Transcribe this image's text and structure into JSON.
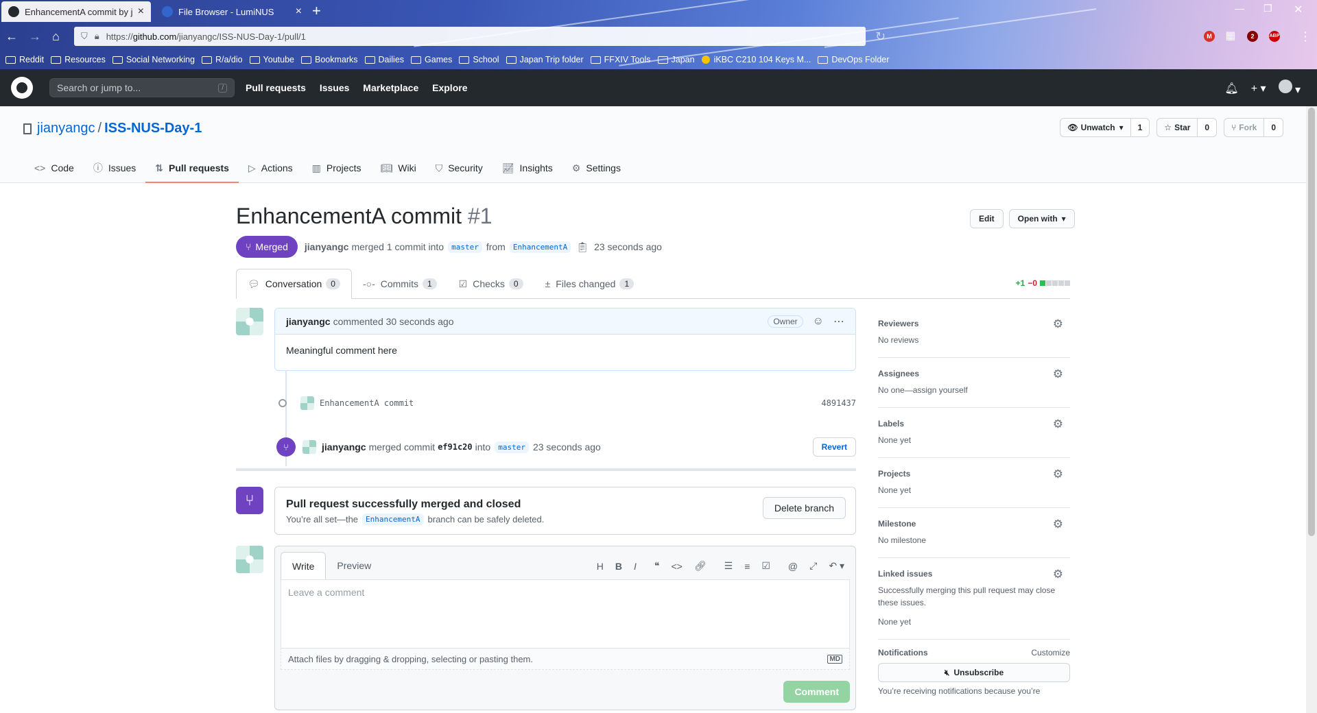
{
  "browser": {
    "tabs": [
      {
        "title": "EnhancementA commit by jian",
        "active": true
      },
      {
        "title": "File Browser - LumiNUS",
        "active": false
      }
    ],
    "url_prefix": "https://",
    "url_host": "github.com",
    "url_path": "/jianyangc/ISS-NUS-Day-1/pull/1",
    "bookmarks": [
      "Reddit",
      "Resources",
      "Social Networking",
      "R/a/dio",
      "Youtube",
      "Bookmarks",
      "Dailies",
      "Games",
      "School",
      "Japan Trip folder",
      "FFXIV Tools",
      "Japan",
      "iKBC C210 104 Keys M...",
      "DevOps Folder"
    ],
    "ext_badge": "2"
  },
  "github": {
    "search_placeholder": "Search or jump to...",
    "search_key": "/",
    "nav": [
      "Pull requests",
      "Issues",
      "Marketplace",
      "Explore"
    ]
  },
  "repo": {
    "owner": "jianyangc",
    "separator": "/",
    "name": "ISS-NUS-Day-1",
    "unwatch_label": "Unwatch",
    "watch_count": "1",
    "star_label": "Star",
    "star_count": "0",
    "fork_label": "Fork",
    "fork_count": "0",
    "tabs": [
      "Code",
      "Issues",
      "Pull requests",
      "Actions",
      "Projects",
      "Wiki",
      "Security",
      "Insights",
      "Settings"
    ]
  },
  "pr": {
    "title": "EnhancementA commit",
    "number": "#1",
    "edit_label": "Edit",
    "open_with_label": "Open with",
    "state": "Merged",
    "author": "jianyangc",
    "meta_text": "merged 1 commit into",
    "base_branch": "master",
    "from_text": "from",
    "head_branch": "EnhancementA",
    "time": "23 seconds ago",
    "tabs": [
      {
        "label": "Conversation",
        "count": "0"
      },
      {
        "label": "Commits",
        "count": "1"
      },
      {
        "label": "Checks",
        "count": "0"
      },
      {
        "label": "Files changed",
        "count": "1"
      }
    ],
    "additions": "+1",
    "deletions": "−0"
  },
  "timeline": {
    "comment_author": "jianyangc",
    "comment_meta": "commented 30 seconds ago",
    "owner_badge": "Owner",
    "comment_body": "Meaningful comment here",
    "commit_message": "EnhancementA commit",
    "commit_sha": "4891437",
    "merge_author": "jianyangc",
    "merge_text": "merged commit",
    "merge_sha": "ef91c20",
    "into_text": "into",
    "merge_base": "master",
    "merge_time": "23 seconds ago",
    "revert_label": "Revert"
  },
  "mergebox": {
    "heading": "Pull request successfully merged and closed",
    "text_before": "You’re all set—the",
    "branch": "EnhancementA",
    "text_after": "branch can be safely deleted.",
    "delete_label": "Delete branch"
  },
  "new_comment": {
    "write_tab": "Write",
    "preview_tab": "Preview",
    "placeholder": "Leave a comment",
    "attach_text": "Attach files by dragging & dropping, selecting or pasting them.",
    "md_badge": "MD",
    "submit_label": "Comment"
  },
  "sidebar": {
    "reviewers_title": "Reviewers",
    "reviewers_value": "No reviews",
    "assignees_title": "Assignees",
    "assignees_value": "No one—assign yourself",
    "labels_title": "Labels",
    "labels_value": "None yet",
    "projects_title": "Projects",
    "projects_value": "None yet",
    "milestone_title": "Milestone",
    "milestone_value": "No milestone",
    "linked_title": "Linked issues",
    "linked_desc": "Successfully merging this pull request may close these issues.",
    "linked_value": "None yet",
    "notifications_title": "Notifications",
    "customize_label": "Customize",
    "unsubscribe_label": "Unsubscribe",
    "notifications_note": "You’re receiving notifications because you’re"
  }
}
